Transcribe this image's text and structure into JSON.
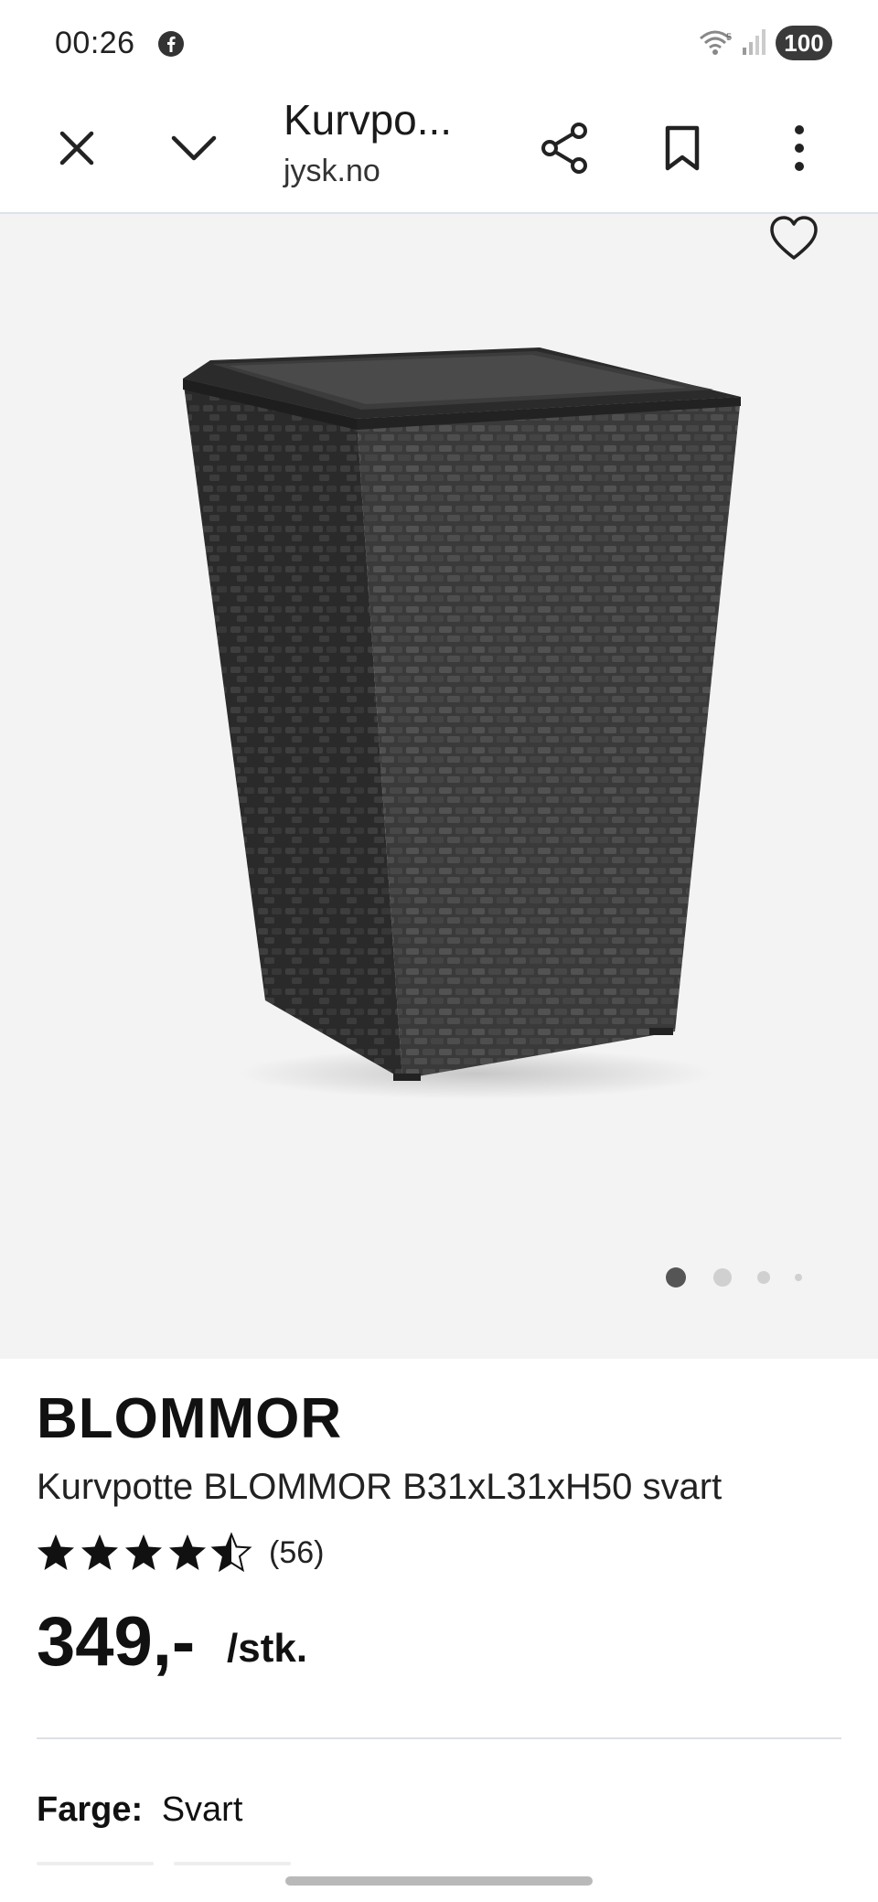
{
  "status_bar": {
    "time": "00:26",
    "battery": "100",
    "icons": [
      "facebook-icon",
      "wifi-icon",
      "signal-icon"
    ]
  },
  "toolbar": {
    "tab_title": "Kurvpo...",
    "url": "jysk.no",
    "icons": [
      "close-icon",
      "chevron-down-icon",
      "share-icon",
      "bookmark-icon",
      "more-vert-icon"
    ]
  },
  "gallery": {
    "image_count": 4,
    "active_index": 0,
    "favorite_icon": "heart-outline-icon"
  },
  "product": {
    "brand": "BLOMMOR",
    "name": "Kurvpotte BLOMMOR B31xL31xH50 svart",
    "rating": 4.5,
    "rating_max": 5,
    "review_count": "(56)",
    "price": "349,-",
    "unit": "/stk.",
    "color_label": "Farge:",
    "color_value": "Svart"
  },
  "colors": {
    "hero_background": "#f3f3f3",
    "active_dot": "#555555",
    "inactive_dot": "#d0d0d0"
  }
}
